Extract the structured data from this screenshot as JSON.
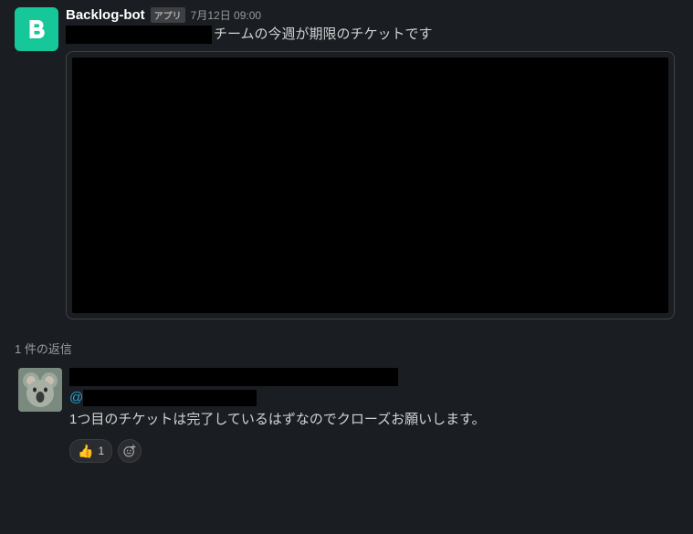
{
  "main_message": {
    "sender": "Backlog-bot",
    "badge": "アプリ",
    "timestamp": "7月12日 09:00",
    "text_suffix": "チームの今週が期限のチケットです"
  },
  "thread": {
    "header": "1 件の返信"
  },
  "reply": {
    "mention_prefix": "@",
    "text": "1つ目のチケットは完了しているはずなのでクローズお願いします。"
  },
  "reactions": {
    "thumbsup": {
      "emoji": "👍",
      "count": "1"
    }
  }
}
